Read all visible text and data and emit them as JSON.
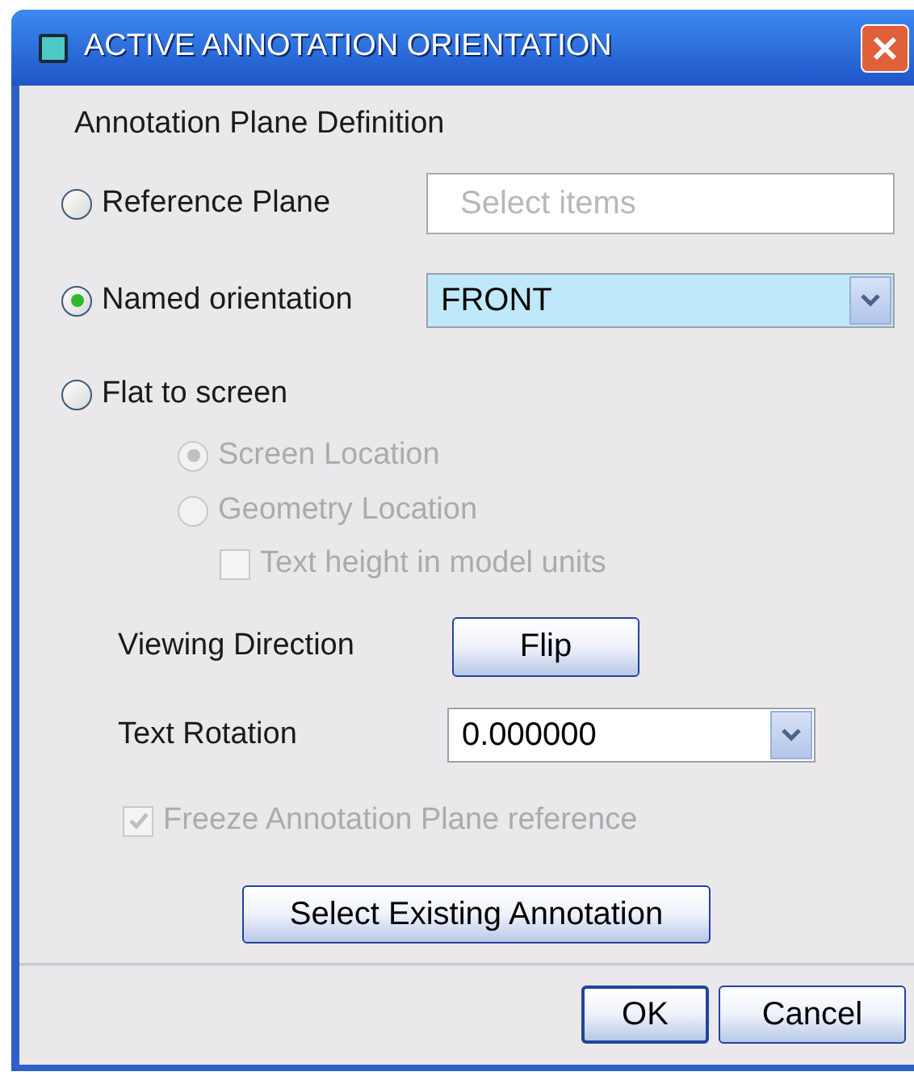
{
  "window": {
    "title": "ACTIVE ANNOTATION ORIENTATION"
  },
  "section_label": "Annotation Plane Definition",
  "plane_options": [
    {
      "label": "Reference Plane",
      "selected": false,
      "field": {
        "kind": "text",
        "placeholder": "Select items"
      }
    },
    {
      "label": "Named orientation",
      "selected": true,
      "field": {
        "kind": "dropdown",
        "value": "FRONT"
      }
    },
    {
      "label": "Flat to screen",
      "selected": false
    }
  ],
  "location_options": [
    {
      "label": "Screen Location",
      "selected": true,
      "disabled": true
    },
    {
      "label": "Geometry Location",
      "selected": false,
      "disabled": true
    }
  ],
  "text_height_checkbox": {
    "label": "Text height in model units",
    "checked": false,
    "disabled": true
  },
  "viewing_direction": {
    "label": "Viewing Direction",
    "button": "Flip"
  },
  "text_rotation": {
    "label": "Text Rotation",
    "value": "0.000000"
  },
  "freeze_checkbox": {
    "label": "Freeze Annotation Plane reference",
    "checked": true,
    "disabled": true
  },
  "select_existing_button": "Select Existing Annotation",
  "buttons": [
    "OK",
    "Cancel"
  ]
}
